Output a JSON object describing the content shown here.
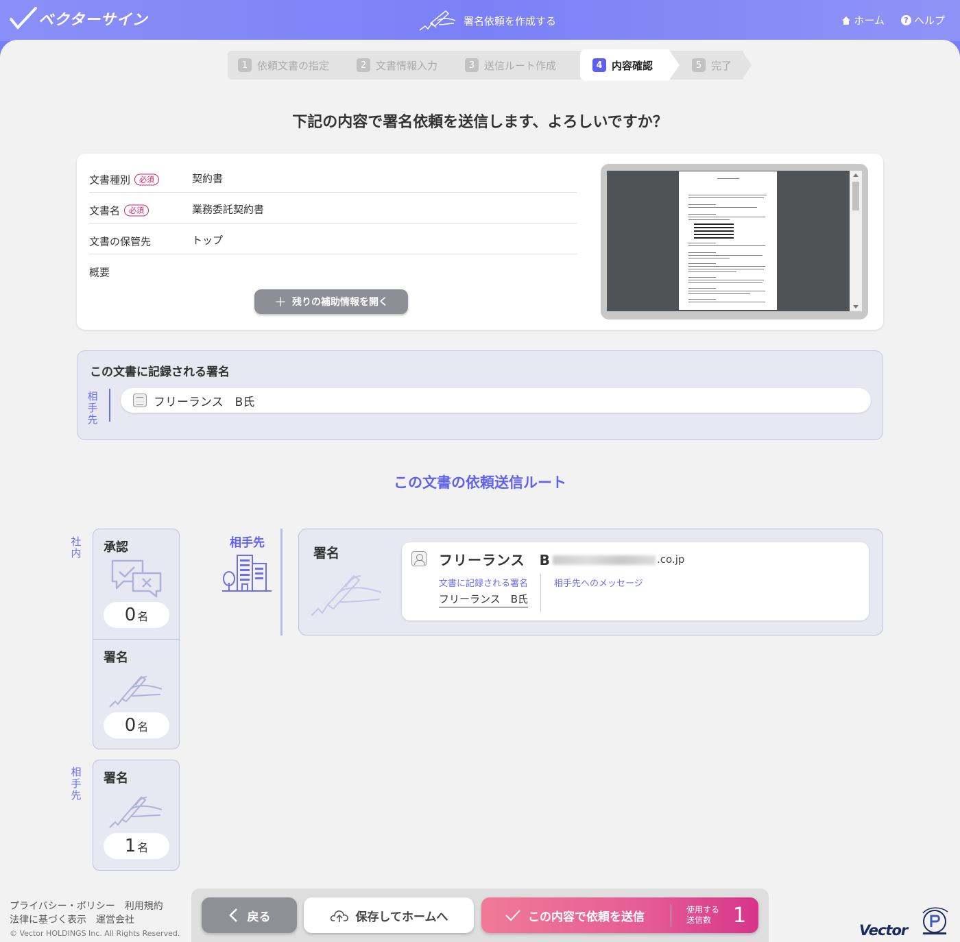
{
  "header": {
    "logo_text": "ベクターサイン",
    "title": "署名依頼を作成する",
    "home_label": "ホーム",
    "help_label": "ヘルプ",
    "help_glyph": "?"
  },
  "steps": [
    {
      "num": "1",
      "label": "依頼文書の指定"
    },
    {
      "num": "2",
      "label": "文書情報入力"
    },
    {
      "num": "3",
      "label": "送信ルート作成"
    },
    {
      "num": "4",
      "label": "内容確認",
      "active": true
    },
    {
      "num": "5",
      "label": "完了"
    }
  ],
  "question": "下記の内容で署名依頼を送信します、よろしいですか？",
  "info": {
    "rows": [
      {
        "label": "文書種別",
        "required": "必須",
        "value": "契約書"
      },
      {
        "label": "文書名",
        "required": "必須",
        "value": "業務委託契約書"
      },
      {
        "label": "文書の保管先",
        "value": "トップ"
      },
      {
        "label": "概要",
        "value": ""
      }
    ],
    "expand_plus": "＋",
    "expand_label": "残りの補助情報を開く"
  },
  "signature_section": {
    "title": "この文書に記録される署名",
    "side_label": "相手先",
    "entry": "フリーランス　B氏"
  },
  "route_title": "この文書の依頼送信ルート",
  "summary": {
    "internal_label": "社内",
    "partner_label": "相手先",
    "approve": {
      "title": "承認",
      "count": "0",
      "unit": "名"
    },
    "internal_sign": {
      "title": "署名",
      "count": "0",
      "unit": "名"
    },
    "partner_sign": {
      "title": "署名",
      "count": "1",
      "unit": "名"
    }
  },
  "route": {
    "partner_label": "相手先",
    "sig_title": "署名",
    "person_name": "フリーランス　B",
    "email_suffix": ".co.jp",
    "recorded_sig_label": "文書に記録される署名",
    "recorded_sig_value": "フリーランス　B氏",
    "message_label": "相手先へのメッセージ"
  },
  "footer": {
    "privacy": "プライバシー・ポリシー",
    "terms": "利用規約",
    "legal": "法律に基づく表示",
    "company": "運営会社",
    "copyright": "© Vector HOLDINGS Inc. All Rights Reserved.",
    "vector_logo": "Vector"
  },
  "actions": {
    "back": "戻る",
    "save": "保存してホームへ",
    "send": "この内容で依頼を送信",
    "send_count_label_1": "使用する",
    "send_count_label_2": "送信数",
    "send_count": "1"
  },
  "colors": {
    "accent": "#5f62ef",
    "header": "#7b80f6",
    "required": "#d3216f",
    "send": "#e55b95"
  }
}
